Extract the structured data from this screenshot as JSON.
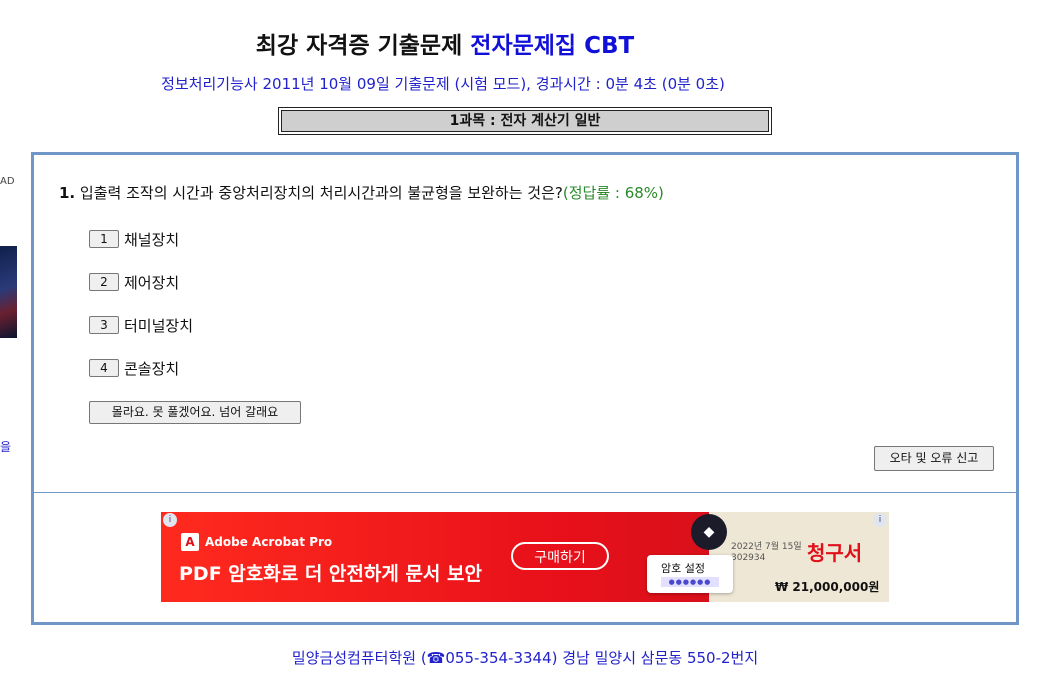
{
  "header": {
    "title_plain": "최강 자격증 기출문제",
    "title_highlight": "전자문제집 CBT",
    "subtitle": "정보처리기능사 2011년 10월 09일 기출문제 (시험 모드), 경과시간 : 0분 4초 (0분 0초)",
    "subject": "1과목 : 전자 계산기 일반"
  },
  "left_strip": {
    "ad_label": "AD",
    "glyph": "을"
  },
  "question": {
    "number": "1.",
    "text": "입출력 조작의 시간과 중앙처리장치의 처리시간과의 불균형을 보완하는 것은?",
    "rate": "(정답률 : 68%)",
    "options": [
      {
        "num": "1",
        "text": "채널장치"
      },
      {
        "num": "2",
        "text": "제어장치"
      },
      {
        "num": "3",
        "text": "터미널장치"
      },
      {
        "num": "4",
        "text": "콘솔장치"
      }
    ],
    "skip_label": "몰라요. 못 풀겠어요. 넘어 갈래요",
    "report_label": "오타 및 오류 신고"
  },
  "ad": {
    "brand": "Adobe Acrobat Pro",
    "headline": "PDF 암호화로 더 안전하게 문서 보안",
    "buy_label": "구매하기",
    "password_label": "암호 설정",
    "password_dots": "●●●●●●",
    "invoice_date": "2022년 7월 15일",
    "invoice_code": "302934",
    "invoice_title": "청구서",
    "invoice_amount": "₩ 21,000,000원",
    "icons": [
      "adobe-logo-icon",
      "shield-icon",
      "ad-choices-icon"
    ]
  },
  "footer": {
    "text": "밀양금성컴퓨터학원 (☎055-354-3344) 경남 밀양시 삼문동 550-2번지"
  },
  "colors": {
    "accent_blue": "#1010d8",
    "link_blue": "#2222cc",
    "rate_green": "#2a8a2a",
    "panel_border": "#6e97c8",
    "ad_red": "#e8101a"
  }
}
